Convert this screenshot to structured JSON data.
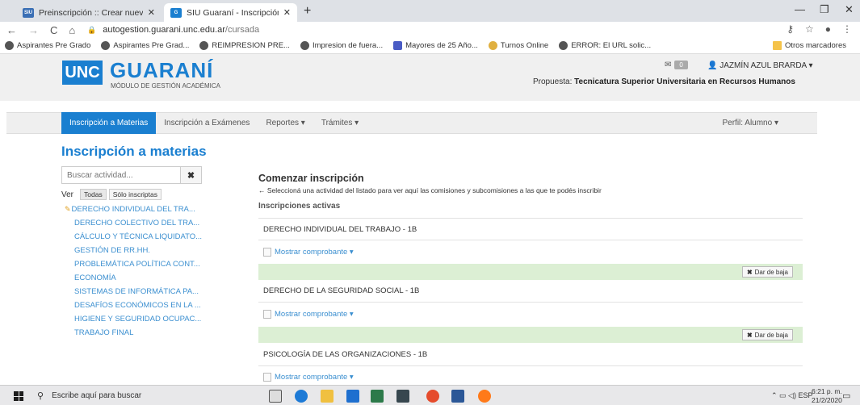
{
  "browser": {
    "tabs": [
      {
        "favicon": "siu",
        "title": "Preinscripción :: Crear nuevo usu"
      },
      {
        "favicon": "G",
        "title": "SIU Guaraní - Inscripción a mater"
      }
    ],
    "url_host": "autogestion.guarani.unc.edu.ar",
    "url_path": "/cursada",
    "bookmarks": [
      "Aspirantes Pre Grado",
      "Aspirantes Pre Grad...",
      "REIMPRESION PRE...",
      "Impresion de fuera...",
      "Mayores de 25 Año...",
      "Turnos Online",
      "ERROR: El URL solic..."
    ],
    "other_bookmarks": "Otros marcadores"
  },
  "header": {
    "logo_unc": "UNC",
    "logo_guarani": "GUARANÍ",
    "logo_sub": "MÓDULO DE GESTIÓN ACADÉMICA",
    "messages_count": "0",
    "user": "JAZMÍN AZUL BRARDA",
    "propuesta_label": "Propuesta:",
    "propuesta_value": "Tecnicatura Superior Universitaria en Recursos Humanos"
  },
  "nav": {
    "items": [
      "Inscripción a Materias",
      "Inscripción a Exámenes",
      "Reportes",
      "Trámites"
    ],
    "perfil": "Perfil: Alumno"
  },
  "page_title": "Inscripción a materias",
  "sidebar": {
    "search_placeholder": "Buscar actividad...",
    "ver_label": "Ver",
    "filter_all": "Todas",
    "filter_only": "Sólo inscriptas",
    "activities": [
      "DERECHO INDIVIDUAL DEL TRA...",
      "DERECHO COLECTIVO DEL TRA...",
      "CÁLCULO Y TÉCNICA LIQUIDATO...",
      "GESTIÓN DE RR.HH.",
      "PROBLEMÁTICA POLÍTICA CONT...",
      "ECONOMÍA",
      "SISTEMAS DE INFORMÁTICA PA...",
      "DESAFÍOS ECONÓMICOS EN LA ...",
      "HIGIENE Y SEGURIDAD OCUPAC...",
      "TRABAJO FINAL"
    ]
  },
  "main": {
    "heading": "Comenzar inscripción",
    "hint": "Seleccioná una actividad del listado para ver aquí las comisiones y subcomisiones a las que te podés inscribir",
    "active_label": "Inscripciones activas",
    "show_receipt": "Mostrar comprobante",
    "drop_label": "Dar de baja",
    "enrollments": [
      "DERECHO INDIVIDUAL DEL TRABAJO - 1B",
      "DERECHO DE LA SEGURIDAD SOCIAL - 1B",
      "PSICOLOGÍA DE LAS ORGANIZACIONES - 1B"
    ]
  },
  "taskbar": {
    "search": "Escribe aquí para buscar",
    "lang": "ESP",
    "time": "6:21 p. m.",
    "date": "21/2/2020"
  },
  "colors": {
    "brand_blue": "#1a7fd0",
    "link_blue": "#3b8fd0",
    "success_bg": "#dcefd4"
  }
}
